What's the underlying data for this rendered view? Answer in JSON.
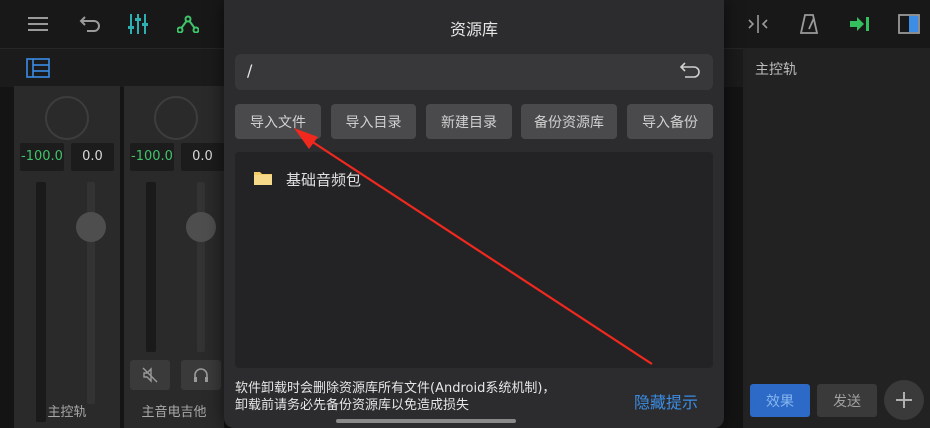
{
  "mixer": {
    "channels": [
      {
        "name": "主控轨",
        "value_left": "-100.0",
        "value_right": "0.0"
      },
      {
        "name": "主音电吉他",
        "value_left": "-100.0",
        "value_right": "0.0"
      }
    ]
  },
  "right_panel": {
    "title": "主控轨",
    "effects_label": "效果",
    "send_label": "发送"
  },
  "dialog": {
    "title": "资源库",
    "path": "/",
    "buttons": [
      "导入文件",
      "导入目录",
      "新建目录",
      "备份资源库",
      "导入备份"
    ],
    "files": [
      {
        "name": "基础音频包",
        "icon": "folder-icon"
      }
    ],
    "hint_line1": "软件卸载时会删除资源库所有文件(Android系统机制)，",
    "hint_line2": "卸载前请务必先备份资源库以免造成损失",
    "hide_hint_label": "隐藏提示"
  },
  "colors": {
    "accent_blue": "#3b8de6",
    "meter_green": "#3fc46a",
    "annotation_red": "#f0281e",
    "effects_button": "#2d6ac8"
  }
}
